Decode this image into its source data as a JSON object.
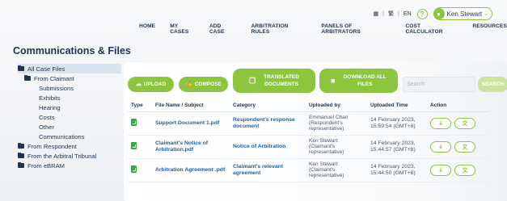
{
  "utility": {
    "lang1": "繁",
    "lang2": "EN",
    "help": "?",
    "user_name": "Ken Stewart"
  },
  "nav": [
    "HOME",
    "MY CASES",
    "ADD CASE",
    "ARBITRATION RULES",
    "PANELS OF ARBITRATORS",
    "COST CALCULATOR",
    "RESOURCES"
  ],
  "page_title": "Communications & Files",
  "tree": {
    "all": "All Case Files",
    "claimant": "From Claimant",
    "claimant_children": [
      "Submissions",
      "Exhibits",
      "Hearing",
      "Costs",
      "Other",
      "Communications"
    ],
    "respondent": "From Respondent",
    "tribunal": "From the Arbitral Tribunal",
    "ebram": "From eBRAM"
  },
  "toolbar": {
    "upload": "UPLOAD",
    "compose": "COMPOSE",
    "translated_line1": "TRANSLATED",
    "translated_line2": "DOCUMENTS",
    "download_line1": "DOWNLOAD ALL",
    "download_line2": "FILES",
    "search_placeholder": "Search",
    "search_button": "SEARCH"
  },
  "table": {
    "headers": [
      "Type",
      "File Name / Subject",
      "Category",
      "Uploaded by",
      "Uploaded Time",
      "Action"
    ],
    "rows": [
      {
        "file": "Support Document 1.pdf",
        "category": "Respondent's response document",
        "uploaded_by": "Emmanuel Chan (Respondent's representative)",
        "time": "14 February 2023, 15:59:54 (GMT+8)"
      },
      {
        "file": "Claimant's Notice of Arbitration.pdf",
        "category": "Notice of Arbitration",
        "uploaded_by": "Ken Stewart (Claimant's representative)",
        "time": "14 February 2023, 15:44:57 (GMT+8)"
      },
      {
        "file": "Arbitration Agreement .pdf",
        "category": "Claimant's relevant agreement",
        "uploaded_by": "Ken Stewart (Claimant's representative)",
        "time": "14 February 2023, 15:44:50 (GMT+8)"
      }
    ]
  },
  "colors": {
    "accent": "#8cc63f",
    "navy": "#1f3350",
    "link": "#1a5fb4"
  }
}
